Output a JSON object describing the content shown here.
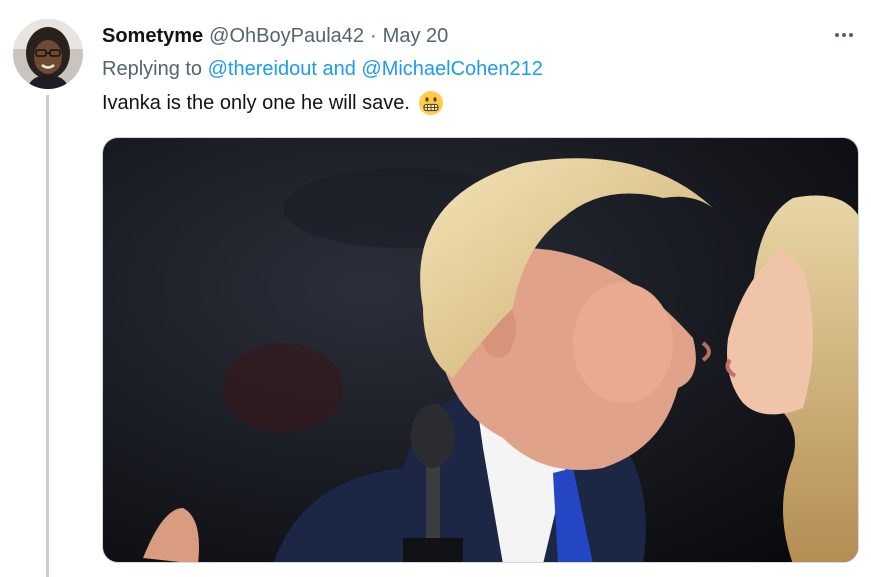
{
  "tweet": {
    "display_name": "Sometyme",
    "handle": "@OhBoyPaula42",
    "separator": "·",
    "date": "May 20",
    "replying_prefix": "Replying to",
    "mention_1": "@thereidout",
    "mention_joiner": "and",
    "mention_2": "@MichaelCohen212",
    "text": "Ivanka is the only one he will save.",
    "emoji_icon": "grimacing-face-icon",
    "more_icon": "more-horizontal-icon"
  },
  "colors": {
    "link": "#1d9bf0",
    "secondary_text": "#536471",
    "primary_text": "#0f1419",
    "thread_line": "#c4cfd6"
  }
}
